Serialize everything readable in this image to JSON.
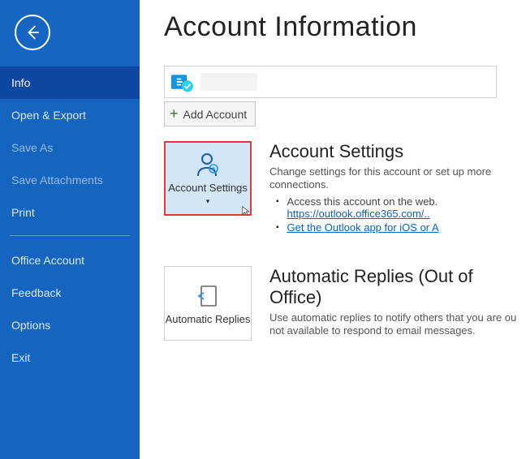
{
  "sidebar": {
    "items": [
      {
        "label": "Info",
        "selected": true
      },
      {
        "label": "Open & Export"
      },
      {
        "label": "Save As",
        "dim": true
      },
      {
        "label": "Save Attachments",
        "dim": true
      },
      {
        "label": "Print"
      },
      {
        "divider": true
      },
      {
        "label": "Office Account"
      },
      {
        "label": "Feedback"
      },
      {
        "label": "Options"
      },
      {
        "label": "Exit"
      }
    ]
  },
  "page": {
    "title": "Account Information",
    "add_account": "Add Account"
  },
  "account_settings": {
    "tile_label": "Account Settings",
    "title": "Account Settings",
    "desc": "Change settings for this account or set up more connections.",
    "b1": "Access this account on the web.",
    "b1_link": "https://outlook.office365.com/..",
    "b2": "Get the Outlook app for iOS or A"
  },
  "auto_replies": {
    "tile_label": "Automatic Replies",
    "title": "Automatic Replies (Out of Office)",
    "desc": "Use automatic replies to notify others that you are ou not available to respond to email messages."
  }
}
